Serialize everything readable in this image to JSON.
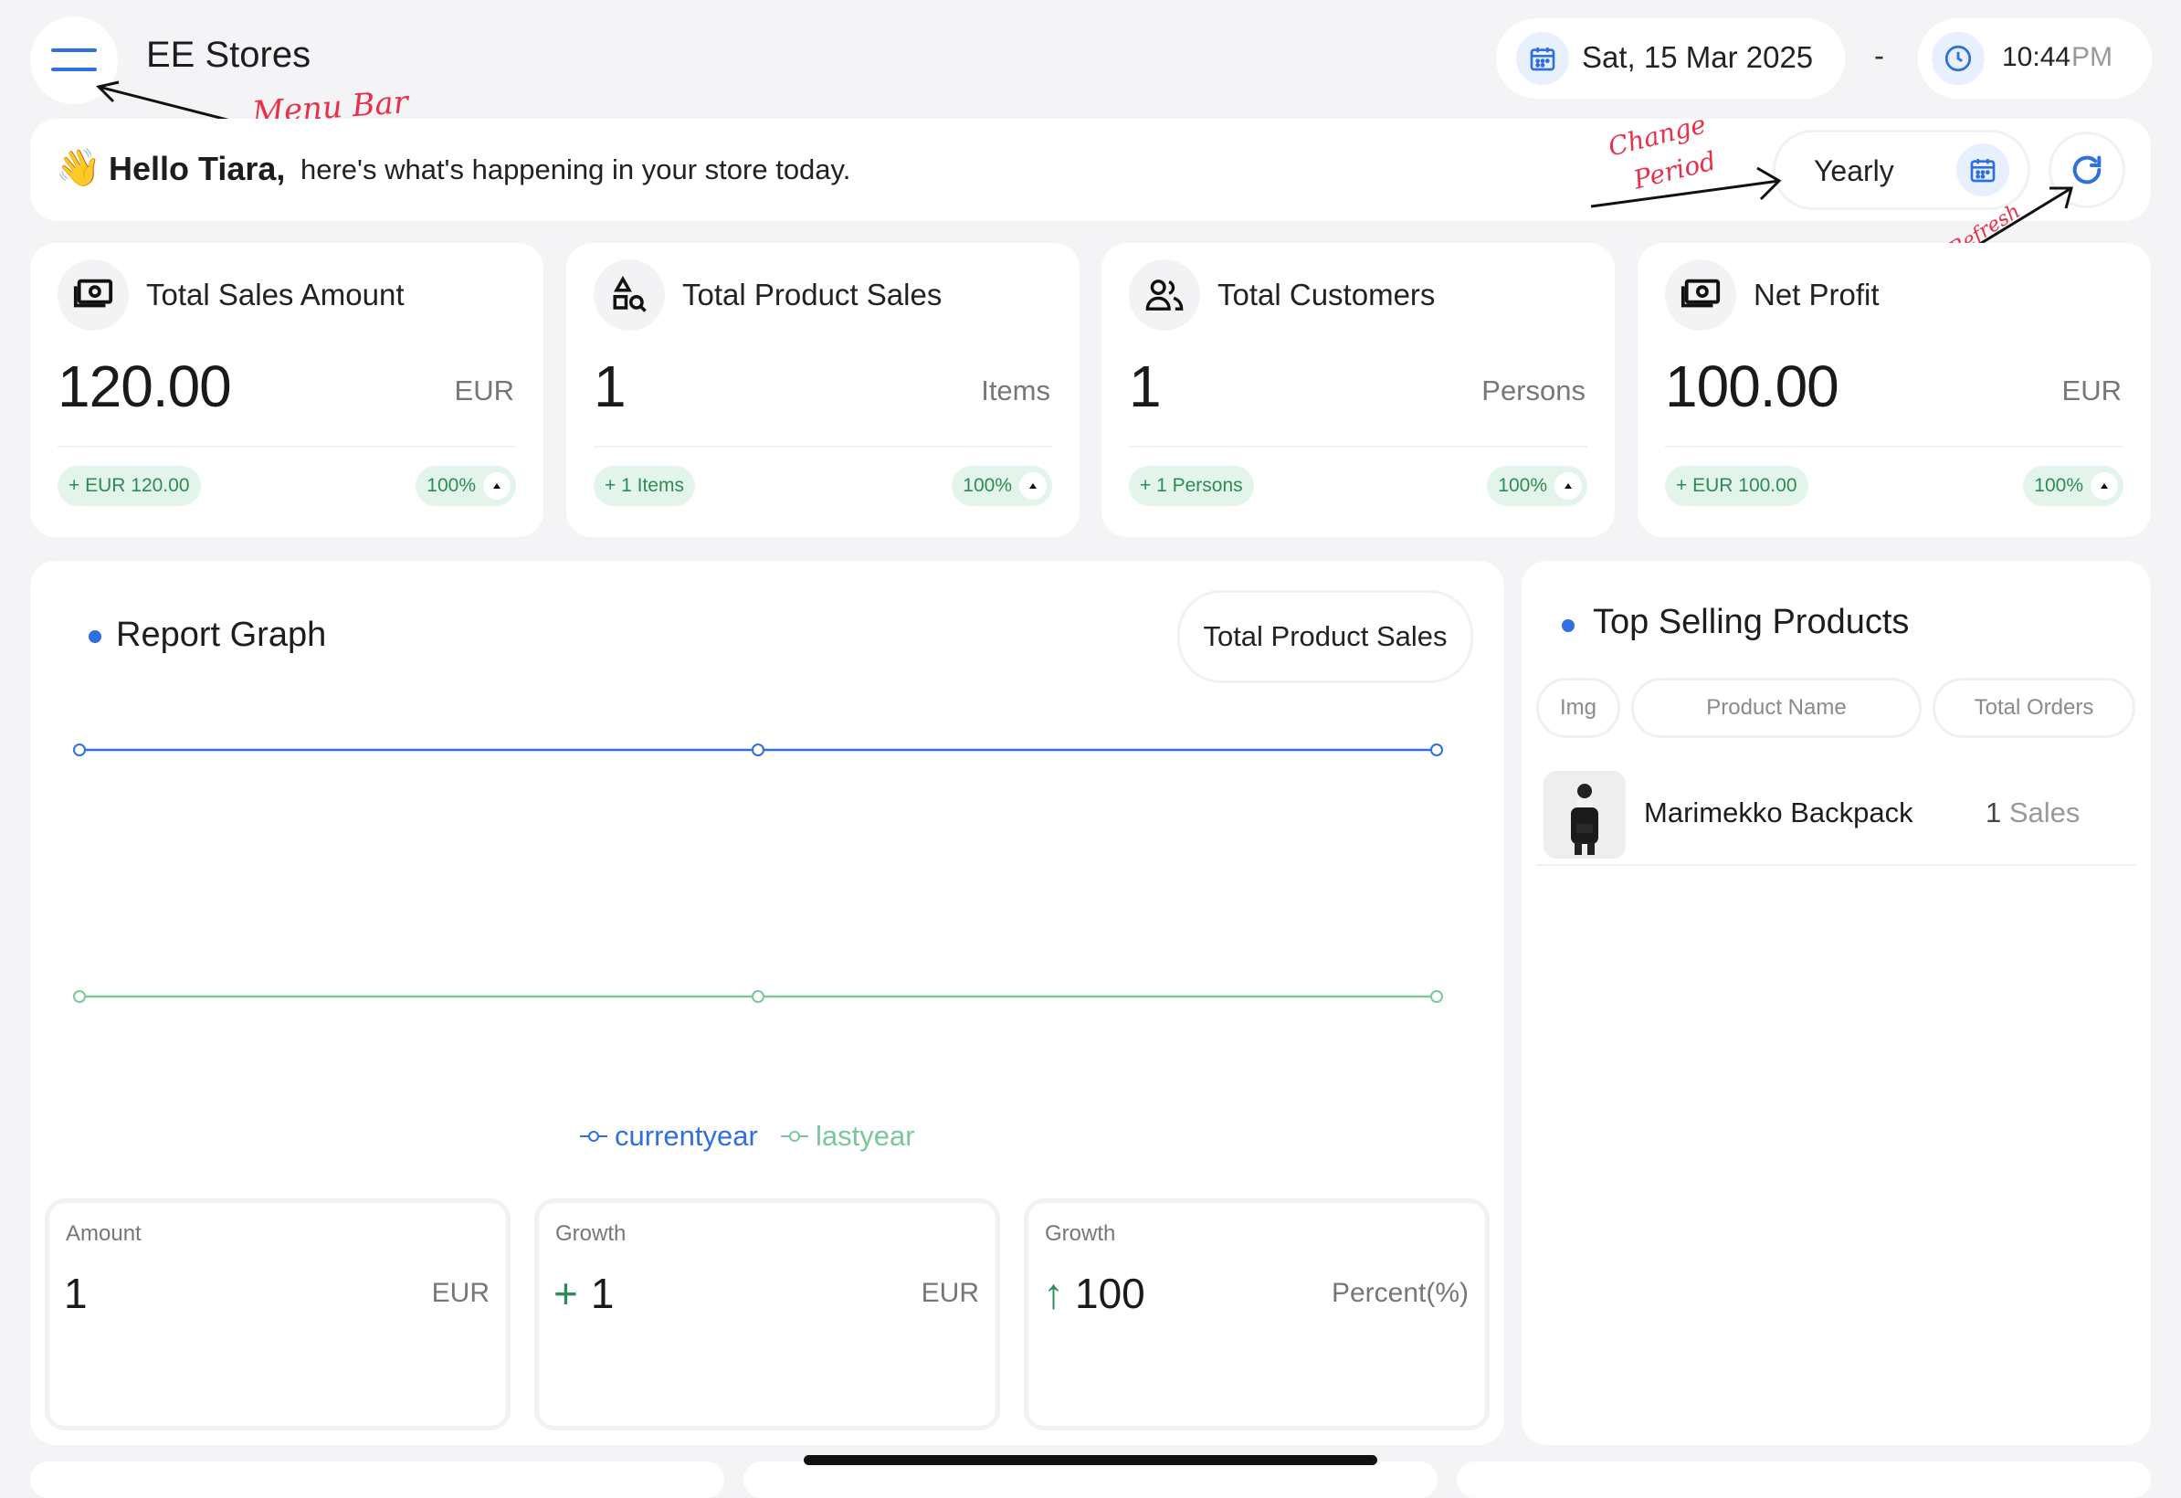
{
  "header": {
    "store_name": "EE Stores",
    "date": "Sat, 15 Mar 2025",
    "separator": "-",
    "time": "10:44",
    "ampm": "PM"
  },
  "greeting": {
    "emoji": "👋",
    "name": "Hello Tiara,",
    "message": "here's what's happening in your store today.",
    "period": "Yearly"
  },
  "annotations": {
    "menu": "Menu Bar",
    "period_line1": "Change",
    "period_line2": "Period",
    "refresh": "Refresh"
  },
  "kpis": [
    {
      "title": "Total Sales Amount",
      "value": "120.00",
      "unit": "EUR",
      "delta": "+ EUR 120.00",
      "pct": "100%",
      "icon": "cash-icon"
    },
    {
      "title": "Total Product Sales",
      "value": "1",
      "unit": "Items",
      "delta": "+ 1 Items",
      "pct": "100%",
      "icon": "shapes-search-icon"
    },
    {
      "title": "Total Customers",
      "value": "1",
      "unit": "Persons",
      "delta": "+ 1 Persons",
      "pct": "100%",
      "icon": "users-icon"
    },
    {
      "title": "Net Profit",
      "value": "100.00",
      "unit": "EUR",
      "delta": "+ EUR 100.00",
      "pct": "100%",
      "icon": "cash-icon"
    }
  ],
  "report": {
    "title": "Report Graph",
    "selector": "Total Product Sales",
    "metrics": [
      {
        "label": "Amount",
        "prefix": "",
        "value": "1",
        "unit": "EUR"
      },
      {
        "label": "Growth",
        "prefix": "+",
        "value": "1",
        "unit": "EUR"
      },
      {
        "label": "Growth",
        "prefix": "↑",
        "value": "100",
        "unit": "Percent(%)"
      }
    ]
  },
  "chart_data": {
    "type": "line",
    "x_points": 3,
    "series": [
      {
        "name": "currentyear",
        "values": [
          1,
          1,
          1
        ],
        "color": "#2f6fe0"
      },
      {
        "name": "lastyear",
        "values": [
          0,
          0,
          0
        ],
        "color": "#7cc79a"
      }
    ],
    "ylim": [
      0,
      1
    ],
    "grid": false,
    "legend": "bottom"
  },
  "top_selling": {
    "title": "Top Selling Products",
    "headers": [
      "Img",
      "Product Name",
      "Total Orders"
    ],
    "rows": [
      {
        "name": "Marimekko Backpack",
        "count": "1",
        "suffix": "Sales"
      }
    ]
  },
  "colors": {
    "accent": "#2f6fe0",
    "positive": "#2e8b57",
    "positive_bg": "#e3f5ea",
    "annotation": "#e8304a"
  }
}
